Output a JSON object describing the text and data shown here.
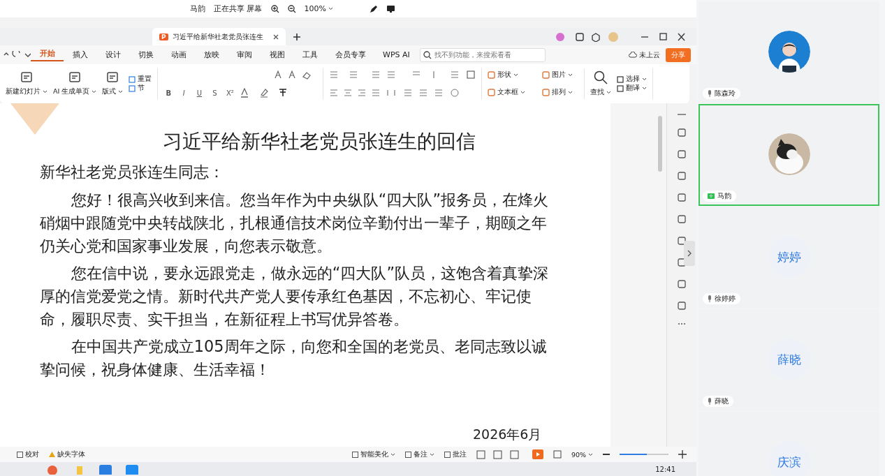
{
  "share_bar": {
    "presenter": "马韵",
    "status": "正在共享 屏幕",
    "zoom": "100%"
  },
  "doc_tab": {
    "app_letter": "P",
    "title": "习近平给新华社老党员张连生"
  },
  "menu_tabs": [
    {
      "label": "开始",
      "selected": true
    },
    {
      "label": "插入",
      "selected": false
    },
    {
      "label": "设计",
      "selected": false
    },
    {
      "label": "切换",
      "selected": false
    },
    {
      "label": "动画",
      "selected": false
    },
    {
      "label": "放映",
      "selected": false
    },
    {
      "label": "审阅",
      "selected": false
    },
    {
      "label": "视图",
      "selected": false
    },
    {
      "label": "工具",
      "selected": false
    },
    {
      "label": "会员专享",
      "selected": false
    }
  ],
  "ai_button": "WPS AI",
  "search": {
    "placeholder": "找不到功能，来搜索看看"
  },
  "cloud_status": "未上云",
  "share_button": "分享",
  "ribbon": {
    "big_buttons": [
      "新建幻灯片",
      "AI 生成单页",
      "版式"
    ],
    "small_buttons": [
      "重置",
      "节"
    ],
    "format_buttons": [
      "B",
      "I",
      "U",
      "S",
      "X²"
    ],
    "insert_buttons": [
      "形状",
      "图片",
      "文本框",
      "排列"
    ],
    "find_button": "查找",
    "edit_buttons": [
      "选择",
      "翻译"
    ]
  },
  "slide": {
    "title": "习近平给新华社老党员张连生的回信",
    "salutation": "新华社老党员张连生同志：",
    "paragraphs": [
      "您好！很高兴收到来信。您当年作为中央纵队“四大队”报务员，在烽火硝烟中跟随党中央转战陕北，扎根通信技术岗位辛勤付出一辈子，期颐之年仍关心党和国家事业发展，向您表示敬意。",
      "您在信中说，要永远跟党走，做永远的“四大队”队员，这饱含着真挚深厚的信党爱党之情。新时代共产党人要传承红色基因，不忘初心、牢记使命，履职尽责、实干担当，在新征程上书写优异答卷。",
      "在中国共产党成立105周年之际，向您和全国的老党员、老同志致以诚挚问候，祝身体健康、生活幸福！"
    ],
    "date": "2026年6月"
  },
  "status_bar": {
    "left": [
      "校对",
      "缺失字体"
    ],
    "right": [
      "智能美化",
      "备注",
      "批注"
    ],
    "zoom": "90%",
    "zoom_slider": {
      "level": 0.55
    }
  },
  "taskbar": {
    "time": "12:41"
  },
  "participants": [
    {
      "name": "陈森玲",
      "kind": "person",
      "selected": false,
      "sharing": false
    },
    {
      "name": "马韵",
      "kind": "pet",
      "selected": true,
      "sharing": true
    },
    {
      "name": "徐婷婷",
      "kind": "initials",
      "avatar_text": "婷婷",
      "selected": false,
      "sharing": false
    },
    {
      "name": "薛晓",
      "kind": "initials",
      "avatar_text": "薛晓",
      "selected": false,
      "sharing": false
    },
    {
      "kind": "initials",
      "avatar_text": "庆滨",
      "selected": false
    }
  ]
}
